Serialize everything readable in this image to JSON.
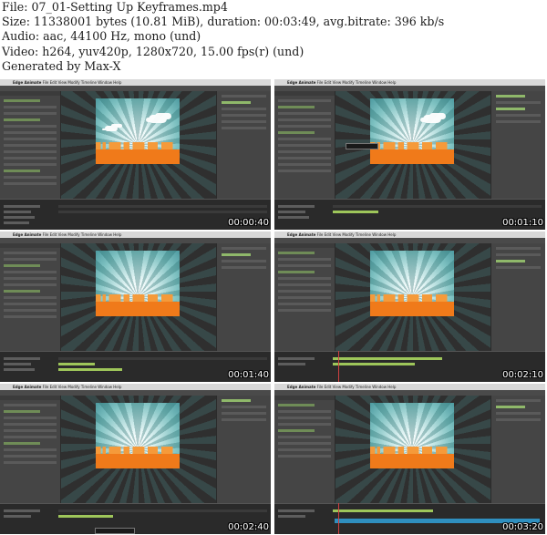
{
  "header": {
    "file_line": "File: 07_01-Setting Up Keyframes.mp4",
    "size_line": "Size: 11338001 bytes (10.81 MiB), duration: 00:03:49, avg.bitrate: 396 kb/s",
    "audio_line": "Audio: aac, 44100 Hz, mono (und)",
    "video_line": "Video: h264, yuv420p, 1280x720, 15.00 fps(r) (und)",
    "generated_line": "Generated by Max-X"
  },
  "thumbnails": [
    {
      "timestamp": "00:00:40"
    },
    {
      "timestamp": "00:01:10"
    },
    {
      "timestamp": "00:01:40"
    },
    {
      "timestamp": "00:02:10"
    },
    {
      "timestamp": "00:02:40"
    },
    {
      "timestamp": "00:03:20"
    }
  ],
  "app": {
    "name": "Edge Animate",
    "menu": "File  Edit  View  Modify  Timeline  Window  Help"
  },
  "colors": {
    "city": "#f07a1a",
    "sky": "#7fc2c2",
    "keyframe": "#9ec65a",
    "timeline_selection": "#2f8fbf"
  }
}
